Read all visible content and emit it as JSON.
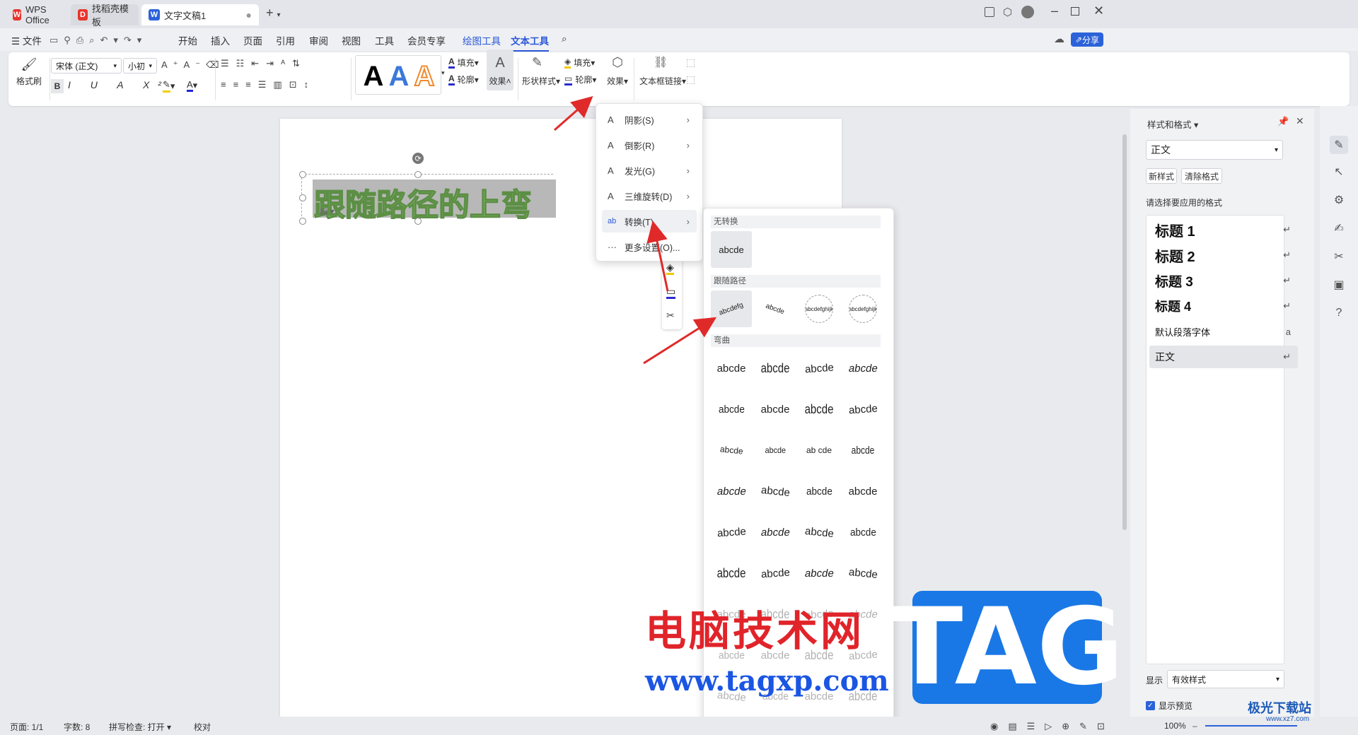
{
  "titlebar": {
    "tabs": [
      {
        "label": "WPS Office",
        "color": "#e8352d"
      },
      {
        "label": "找稻壳模板",
        "color": "#e8352d"
      },
      {
        "label": "文字文稿1",
        "color": "#2b62d9"
      }
    ],
    "new_tab": "+"
  },
  "menubar": {
    "file": "文件",
    "items": [
      "开始",
      "插入",
      "页面",
      "引用",
      "审阅",
      "视图",
      "工具",
      "会员专享",
      "绘图工具",
      "文本工具"
    ],
    "active": "文本工具",
    "share": "分享"
  },
  "ribbon": {
    "format_painter": "格式刷",
    "font_name": "宋体 (正文)",
    "font_size": "小初",
    "fill": "填充",
    "outline": "轮廓",
    "effect": "效果",
    "shape_style": "形状样式",
    "shape_fill": "填充",
    "shape_outline": "轮廓",
    "shape_effect": "效果",
    "textbox_link": "文本框链接",
    "text_effect_samples": [
      "A",
      "A",
      "A"
    ]
  },
  "document": {
    "wordart_text": "跟随路径的上弯"
  },
  "effect_menu": {
    "items": [
      {
        "label": "阴影(S)",
        "icon": "A"
      },
      {
        "label": "倒影(R)",
        "icon": "A"
      },
      {
        "label": "发光(G)",
        "icon": "A"
      },
      {
        "label": "三维旋转(D)",
        "icon": "A"
      },
      {
        "label": "转换(T)",
        "icon": "ab"
      },
      {
        "label": "更多设置(O)...",
        "icon": "···"
      }
    ]
  },
  "transform_menu": {
    "no_transform_header": "无转换",
    "no_transform_sample": "abcde",
    "follow_path_header": "跟随路径",
    "follow_path_samples": [
      "abcdefg",
      "abcde",
      "abcdefghijk",
      "abcdefghijk"
    ],
    "warp_header": "弯曲",
    "warp_samples": [
      "abcde",
      "abcde",
      "abcde",
      "abcde",
      "abcde",
      "abcde",
      "abcde",
      "abcde",
      "abcde",
      "abcde",
      "ab cde",
      "abcde",
      "abcde",
      "abcde",
      "abcde",
      "abcde",
      "abcde",
      "abcde",
      "abcde",
      "abcde",
      "abcde",
      "abcde",
      "abcde",
      "abcde",
      "abcde",
      "abcde",
      "abcde",
      "abcde",
      "abcde",
      "abcde",
      "abcde",
      "abcde",
      "abcde",
      "abcde",
      "abcde",
      "abcde"
    ]
  },
  "style_panel": {
    "title": "样式和格式",
    "current_style": "正文",
    "new_style": "新样式",
    "clear_format": "清除格式",
    "apply_label": "请选择要应用的格式",
    "styles": [
      {
        "label": "标题 1"
      },
      {
        "label": "标题 2"
      },
      {
        "label": "标题 3"
      },
      {
        "label": "标题 4"
      },
      {
        "label": "默认段落字体"
      },
      {
        "label": "正文"
      }
    ],
    "show_label": "显示",
    "show_value": "有效样式",
    "preview_label": "显示预览"
  },
  "statusbar": {
    "page": "页面: 1/1",
    "words": "字数: 8",
    "spellcheck": "拼写检查: 打开",
    "proofread": "校对",
    "zoom": "100%"
  },
  "watermark": {
    "title": "电脑技术网",
    "url": "www.tagxp.com",
    "tag": "TAG",
    "corner": "极光下载站",
    "corner_url": "www.xz7.com"
  }
}
